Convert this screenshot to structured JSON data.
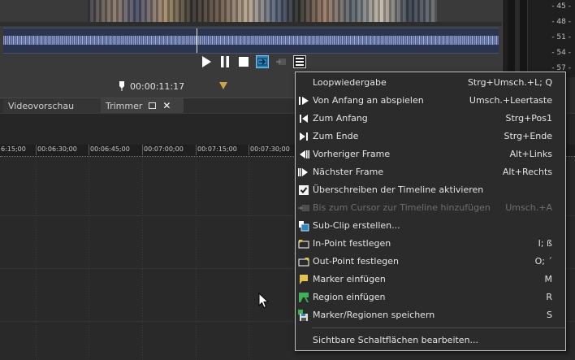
{
  "trimmer": {
    "timecode": "00:00:11:17"
  },
  "panel_tabs": {
    "videopreview_label": "Videovorschau",
    "trimmer_label": "Trimmer",
    "close_symbol": "✕"
  },
  "meter": {
    "labels": [
      "- 45 -",
      "- 48 -",
      "- 51 -",
      "- 54 -",
      "- 57 -"
    ]
  },
  "timeline": {
    "ruler_labels": [
      "6:15;00",
      "00:06:30;00",
      "00:06:45;00",
      "00:07:00;00",
      "00:07:15;00",
      "00:07:30;00"
    ]
  },
  "context_menu": {
    "items": [
      {
        "label": "Loopwiedergabe",
        "shortcut": "Strg+Umsch.+L; Q",
        "icon": "none",
        "enabled": true
      },
      {
        "label": "Von Anfang an abspielen",
        "shortcut": "Umsch.+Leertaste",
        "icon": "play-from-start-icon",
        "enabled": true
      },
      {
        "label": "Zum Anfang",
        "shortcut": "Strg+Pos1",
        "icon": "go-to-start-icon",
        "enabled": true
      },
      {
        "label": "Zum Ende",
        "shortcut": "Strg+Ende",
        "icon": "go-to-end-icon",
        "enabled": true
      },
      {
        "label": "Vorheriger Frame",
        "shortcut": "Alt+Links",
        "icon": "previous-frame-icon",
        "enabled": true
      },
      {
        "label": "Nächster Frame",
        "shortcut": "Alt+Rechts",
        "icon": "next-frame-icon",
        "enabled": true
      },
      {
        "label": "Überschreiben der Timeline aktivieren",
        "shortcut": "",
        "icon": "checkbox-checked-icon",
        "enabled": true
      },
      {
        "label": "Bis zum Cursor zur Timeline hinzufügen",
        "shortcut": "Umsch.+A",
        "icon": "add-to-cursor-icon",
        "enabled": false
      },
      {
        "label": "Sub-Clip erstellen...",
        "shortcut": "",
        "icon": "subclip-icon",
        "enabled": true
      },
      {
        "label": "In-Point festlegen",
        "shortcut": "I; ß",
        "icon": "in-point-icon",
        "enabled": true
      },
      {
        "label": "Out-Point festlegen",
        "shortcut": "O; ´",
        "icon": "out-point-icon",
        "enabled": true
      },
      {
        "label": "Marker einfügen",
        "shortcut": "M",
        "icon": "marker-icon",
        "enabled": true
      },
      {
        "label": "Region einfügen",
        "shortcut": "R",
        "icon": "region-icon",
        "enabled": true
      },
      {
        "label": "Marker/Regionen speichern",
        "shortcut": "S",
        "icon": "save-markers-icon",
        "enabled": true
      },
      {
        "label": "Sichtbare Schaltflächen bearbeiten...",
        "shortcut": "",
        "icon": "none",
        "enabled": true
      }
    ]
  },
  "colors": {
    "accent_blue": "#2e86c1",
    "marker_yellow": "#e6c14a",
    "region_green": "#3fb15a",
    "menu_bg": "#2b2b2b"
  }
}
